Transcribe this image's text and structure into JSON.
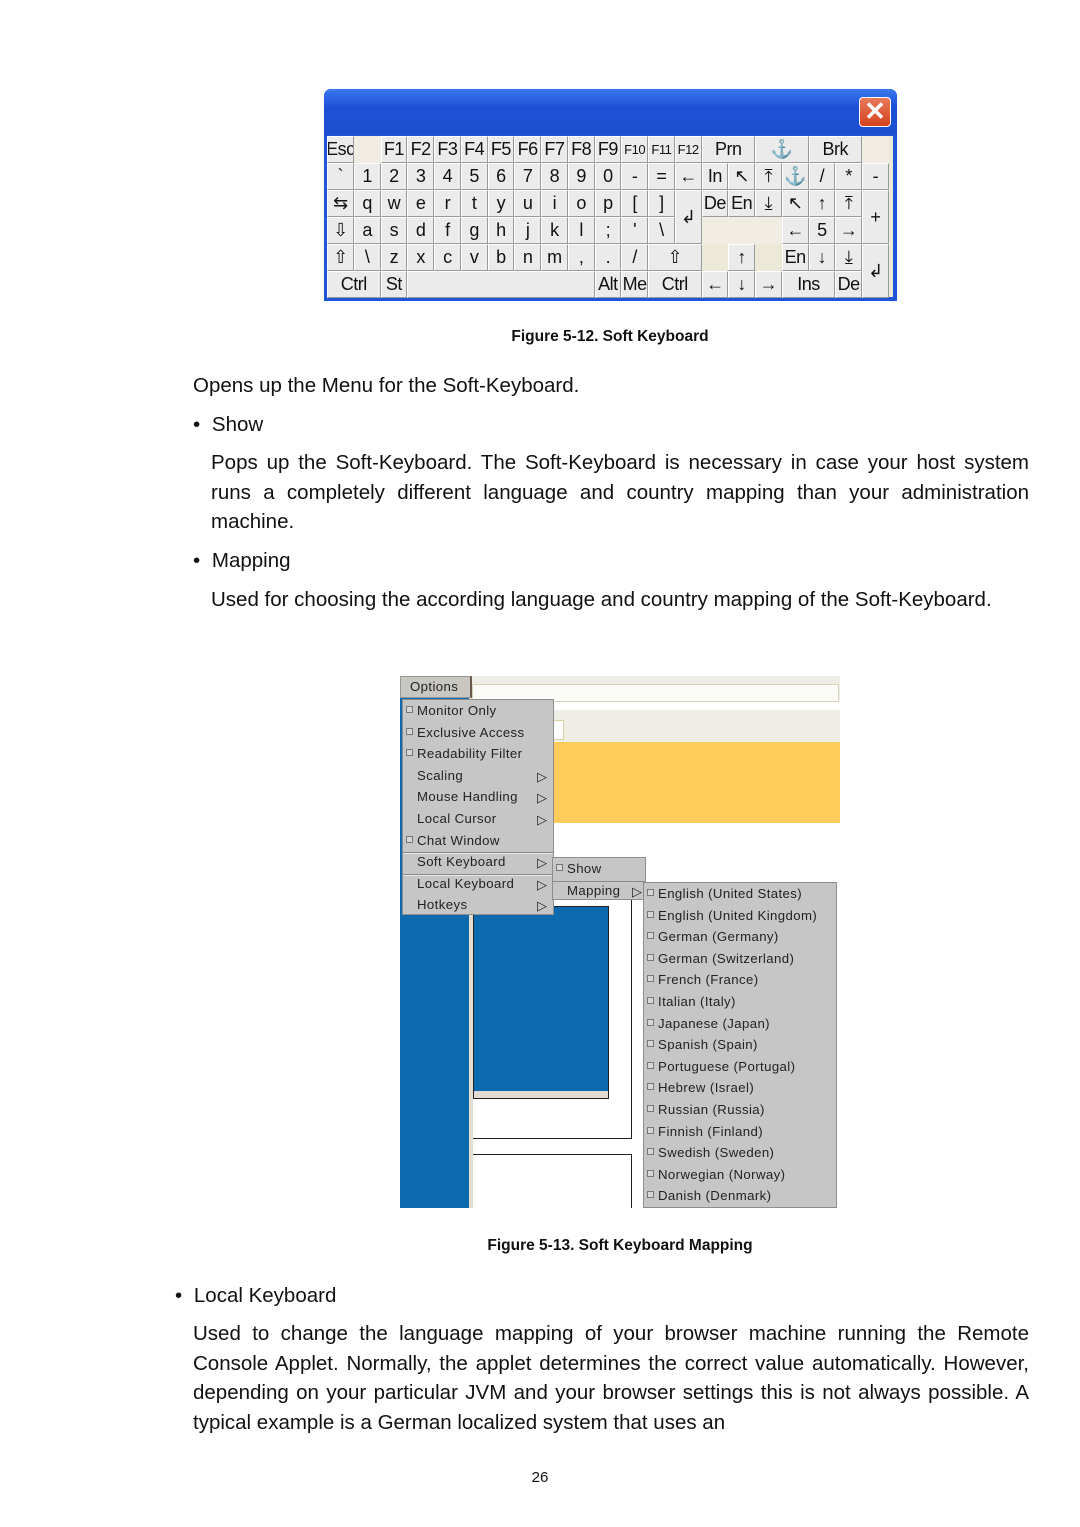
{
  "figure1": {
    "caption": "Figure 5-12. Soft Keyboard",
    "window": {
      "close_icon": "close-icon",
      "title_bar_color": "#1f56d9"
    },
    "keys": {
      "row0": [
        "Esc",
        "",
        "F1",
        "F2",
        "F3",
        "F4",
        "F5",
        "F6",
        "F7",
        "F8",
        "F9",
        "F10",
        "F11",
        "F12",
        "Prn",
        "⚓",
        "Brk",
        ""
      ],
      "row1": [
        "`",
        "1",
        "2",
        "3",
        "4",
        "5",
        "6",
        "7",
        "8",
        "9",
        "0",
        "-",
        "=",
        "←",
        "In",
        "↖",
        "⤒",
        "⚓",
        "/",
        "*",
        "-"
      ],
      "row2": [
        "⇆",
        "q",
        "w",
        "e",
        "r",
        "t",
        "y",
        "u",
        "i",
        "o",
        "p",
        "[",
        "]",
        "↲",
        "De",
        "En",
        "⤓",
        "↖",
        "↑",
        "⤒",
        "+"
      ],
      "row3": [
        "⇩",
        "a",
        "s",
        "d",
        "f",
        "g",
        "h",
        "j",
        "k",
        "l",
        ";",
        "'",
        "\\",
        "",
        "←",
        "5",
        "→"
      ],
      "row4": [
        "⇧",
        "\\",
        "z",
        "x",
        "c",
        "v",
        "b",
        "n",
        "m",
        ",",
        ".",
        "/",
        "⇧",
        "↑",
        "En",
        "↓",
        "⤓",
        "↲"
      ],
      "row5": [
        "Ctrl",
        "St",
        "Alt",
        "",
        "Alt",
        "Me",
        "Ctrl",
        "←",
        "↓",
        "→",
        "Ins",
        "De"
      ]
    }
  },
  "body": {
    "intro": "Opens up the Menu for the Soft-Keyboard.",
    "bullet_show": "Show",
    "show_text": "Pops up the Soft-Keyboard. The Soft-Keyboard is necessary in case your host system runs a completely different language and country mapping than your administration machine.",
    "bullet_mapping": "Mapping",
    "mapping_text": "Used for choosing the according language and country mapping of the Soft-Keyboard.",
    "bullet_local": "Local Keyboard",
    "local_text": "Used to change the language mapping of your browser machine running the Remote Console Applet. Normally, the applet determines the correct value automatically. However, depending on your particular JVM and your browser settings this is not always possible. A typical example is a German localized system that uses an",
    "bullet_char": "•"
  },
  "figure2": {
    "caption": "Figure 5-13. Soft Keyboard Mapping",
    "menu_bar": {
      "options_label": "Options"
    },
    "options_menu": [
      {
        "label": "Monitor Only",
        "type": "check"
      },
      {
        "label": "Exclusive Access",
        "type": "check"
      },
      {
        "label": "Readability Filter",
        "type": "check"
      },
      {
        "label": "Scaling",
        "type": "submenu"
      },
      {
        "label": "Mouse Handling",
        "type": "submenu"
      },
      {
        "label": "Local Cursor",
        "type": "submenu"
      },
      {
        "label": "Chat Window",
        "type": "check"
      },
      {
        "label": "Soft Keyboard",
        "type": "submenu"
      },
      {
        "label": "Local Keyboard",
        "type": "submenu"
      },
      {
        "label": "Hotkeys",
        "type": "submenu"
      }
    ],
    "soft_keyboard_menu": [
      {
        "label": "Show",
        "type": "check"
      },
      {
        "label": "Mapping",
        "type": "submenu"
      }
    ],
    "mapping_menu": [
      "English (United States)",
      "English (United Kingdom)",
      "German (Germany)",
      "German (Switzerland)",
      "French (France)",
      "Italian (Italy)",
      "Japanese (Japan)",
      "Spanish (Spain)",
      "Portuguese (Portugal)",
      "Hebrew (Israel)",
      "Russian (Russia)",
      "Finnish (Finland)",
      "Swedish (Sweden)",
      "Norwegian (Norway)",
      "Danish (Denmark)"
    ],
    "colors": {
      "menu_bg": "#c6c6c6",
      "yellow_panel": "#fdcc5a",
      "blue_panel": "#0d6aae"
    }
  },
  "page_number": "26"
}
